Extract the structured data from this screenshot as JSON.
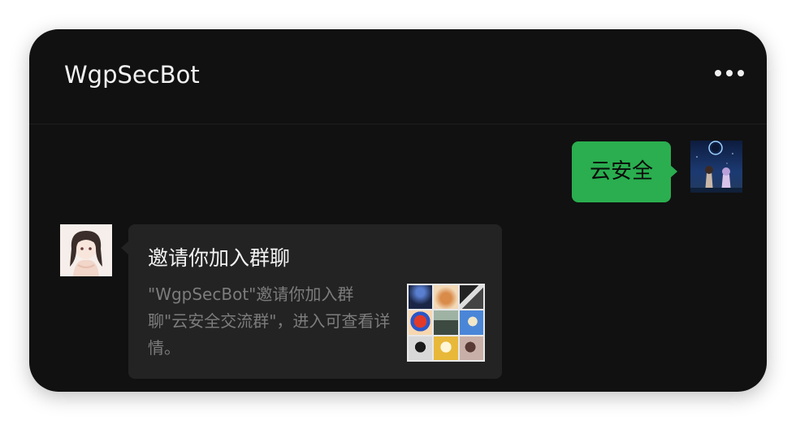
{
  "header": {
    "title": "WgpSecBot",
    "more_icon": "more-dots-icon"
  },
  "messages": {
    "outgoing": {
      "text": "云安全",
      "bubble_color": "#2aae4f"
    },
    "incoming_card": {
      "title": "邀请你加入群聊",
      "description": "\"WgpSecBot\"邀请你加入群聊\"云安全交流群\"，进入可查看详情。"
    }
  },
  "colors": {
    "background": "#111111",
    "card": "#232323",
    "accent_green": "#2aae4f"
  }
}
